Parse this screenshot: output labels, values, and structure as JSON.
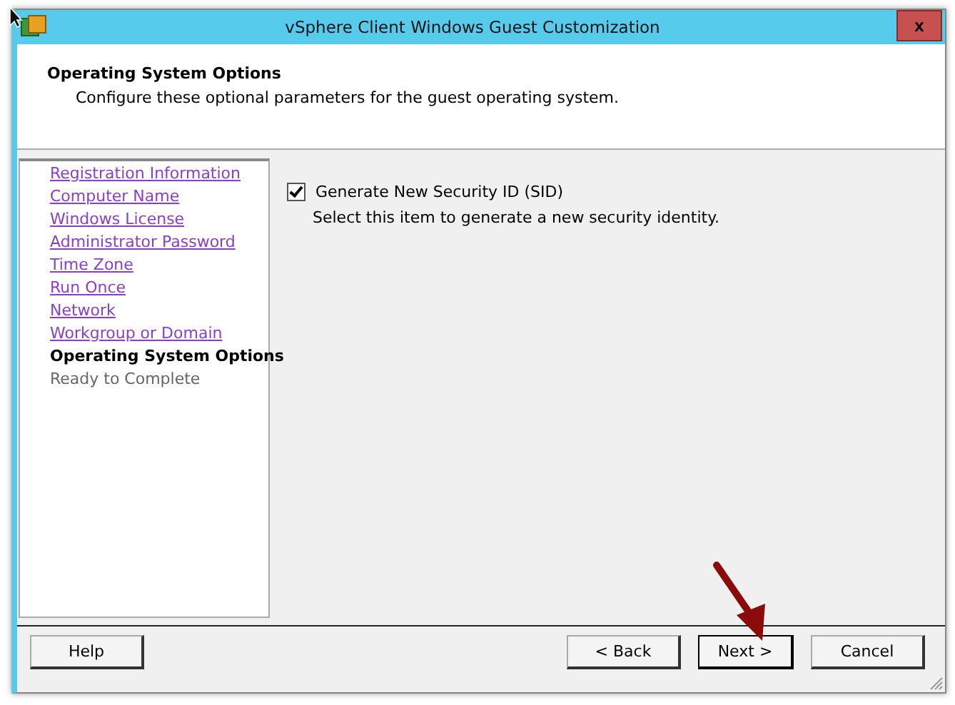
{
  "window": {
    "title": "vSphere Client Windows Guest Customization",
    "close": "x"
  },
  "header": {
    "title": "Operating System Options",
    "subtitle": "Configure these optional parameters for the guest operating system."
  },
  "steps": [
    {
      "label": "Registration Information",
      "kind": "done"
    },
    {
      "label": "Computer Name",
      "kind": "done"
    },
    {
      "label": "Windows License",
      "kind": "done"
    },
    {
      "label": "Administrator Password",
      "kind": "done"
    },
    {
      "label": "Time Zone",
      "kind": "done"
    },
    {
      "label": "Run Once",
      "kind": "done"
    },
    {
      "label": "Network",
      "kind": "done"
    },
    {
      "label": "Workgroup or Domain",
      "kind": "done"
    },
    {
      "label": "Operating System Options",
      "kind": "current"
    },
    {
      "label": "Ready to Complete",
      "kind": "pending"
    }
  ],
  "option": {
    "label": "Generate New Security ID (SID)",
    "checked": true,
    "description": "Select this item to generate a new security identity."
  },
  "buttons": {
    "help": "Help",
    "back": "< Back",
    "next": "Next >",
    "cancel": "Cancel"
  }
}
